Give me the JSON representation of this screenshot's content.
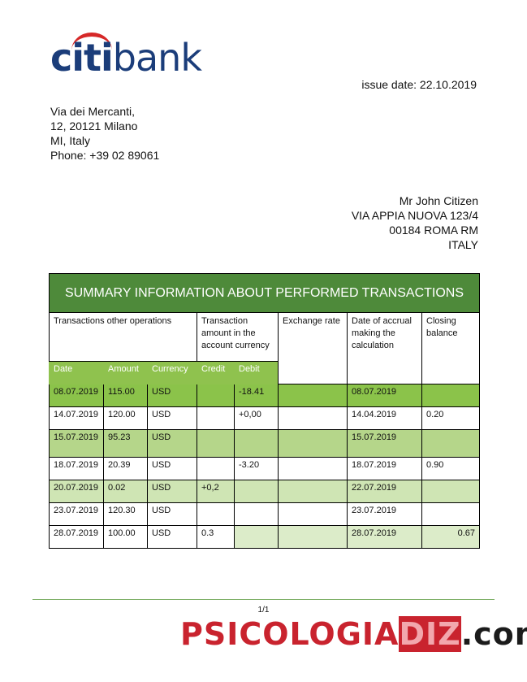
{
  "logo": {
    "part1": "citi",
    "part2": "bank"
  },
  "issue_date": "issue date: 22.10.2019",
  "sender_address": [
    "Via dei Mercanti,",
    "12, 20121 Milano",
    "MI, Italy",
    "Phone: +39 02 89061"
  ],
  "recipient_address": [
    "Mr John Citizen",
    "VIA APPIA NUOVA 123/4",
    "00184 ROMA RM",
    "ITALY"
  ],
  "table": {
    "title": "SUMMARY INFORMATION ABOUT PERFORMED TRANSACTIONS",
    "group_headers": {
      "other_ops": "Transactions other operations",
      "tx_amount": "Transaction amount in the account currency",
      "exchange_rate": "Exchange rate",
      "accrual_date": "Date of accrual making the calculation",
      "closing_balance": "Closing balance"
    },
    "sub_headers": {
      "date": "Date",
      "amount": "Amount",
      "currency": "Currency",
      "credit": "Credit",
      "debit": "Debit"
    },
    "rows": [
      {
        "date": "08.07.2019",
        "amount": "115.00",
        "currency": "USD",
        "credit": "",
        "debit": "-18.41",
        "rate": "",
        "accrual": "08.07.2019",
        "balance": ""
      },
      {
        "date": "14.07.2019",
        "amount": "120.00",
        "currency": "USD",
        "credit": "",
        "debit": "+0,00",
        "rate": "",
        "accrual": "14.04.2019",
        "balance": "0.20"
      },
      {
        "date": "15.07.2019",
        "amount": "95.23",
        "currency": "USD",
        "credit": "",
        "debit": "",
        "rate": "",
        "accrual": "15.07.2019",
        "balance": ""
      },
      {
        "date": "18.07.2019",
        "amount": "20.39",
        "currency": "USD",
        "credit": "",
        "debit": "-3.20",
        "rate": "",
        "accrual": "18.07.2019",
        "balance": "0.90"
      },
      {
        "date": "20.07.2019",
        "amount": "0.02",
        "currency": "USD",
        "credit": "+0,2",
        "debit": "",
        "rate": "",
        "accrual": "22.07.2019",
        "balance": ""
      },
      {
        "date": "23.07.2019",
        "amount": "120.30",
        "currency": "USD",
        "credit": "",
        "debit": "",
        "rate": "",
        "accrual": "23.07.2019",
        "balance": ""
      },
      {
        "date": "28.07.2019",
        "amount": "100.00",
        "currency": "USD",
        "credit": "0.3",
        "debit": "",
        "rate": "",
        "accrual": "28.07.2019",
        "balance": "0.67"
      }
    ]
  },
  "page_number": "1/1",
  "watermark": {
    "part1": "PSICOLOGIA",
    "part2": "DIZ",
    "part3": ".com"
  },
  "colors": {
    "header_green": "#4e8a3a",
    "subheader_green": "#8fc24e",
    "brand_blue": "#1b3d7a",
    "brand_red": "#d62828"
  }
}
